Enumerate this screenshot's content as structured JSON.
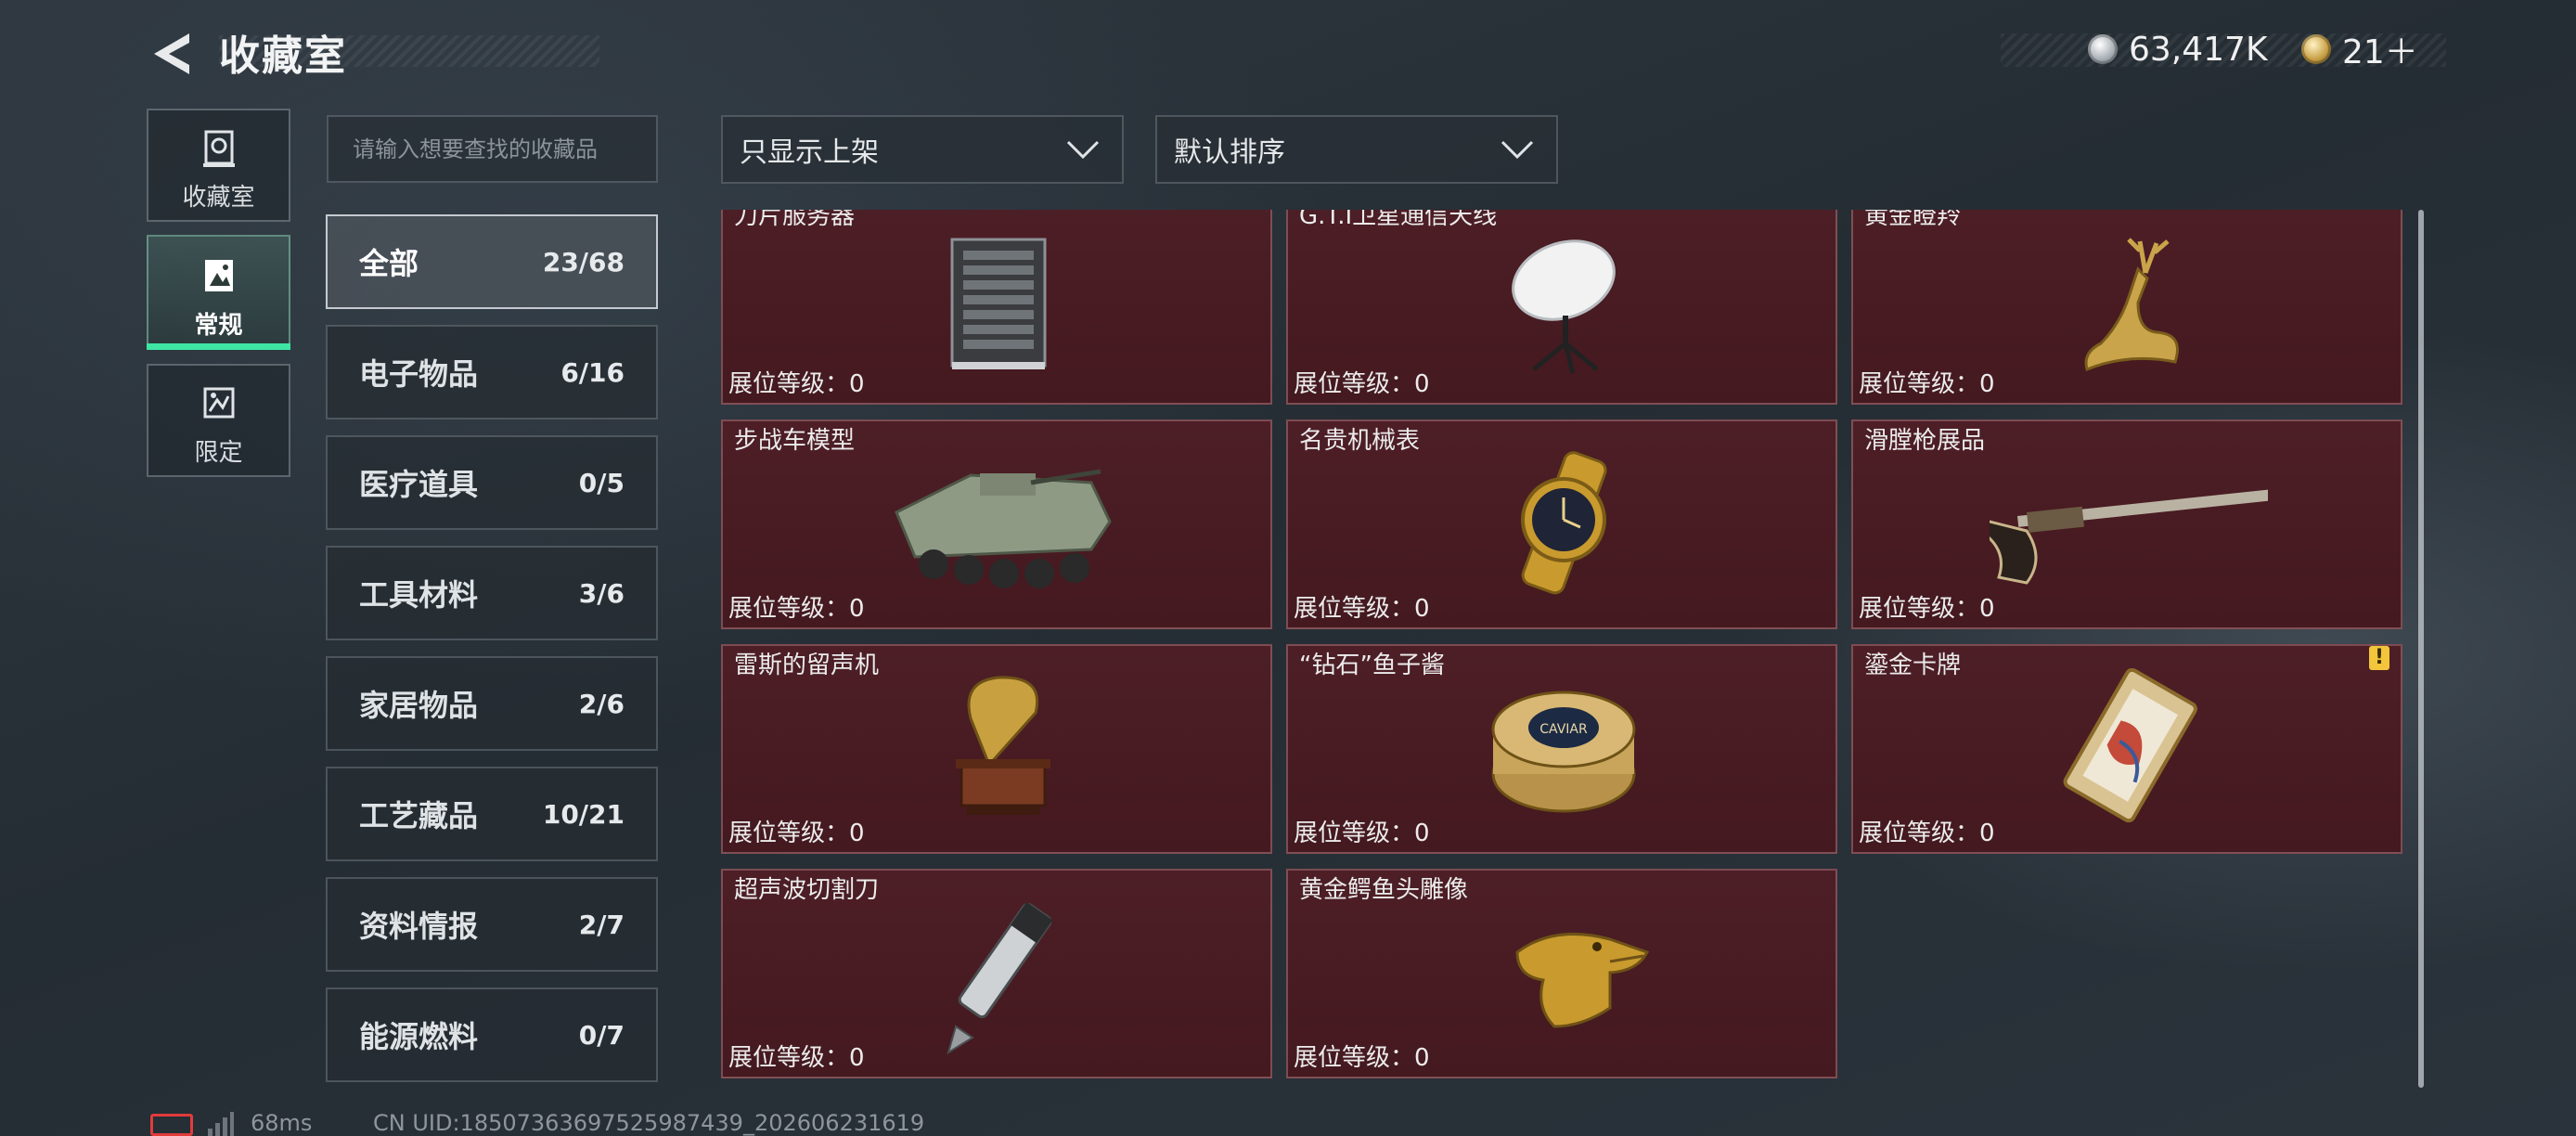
{
  "header": {
    "title": "收藏室",
    "currencies": [
      {
        "icon": "silver-coin-icon",
        "value": "63,417K"
      },
      {
        "icon": "gold-coin-icon",
        "value": "21＋"
      }
    ]
  },
  "rail": {
    "tabs": [
      {
        "label": "收藏室",
        "icon": "collection-room-icon"
      },
      {
        "label": "常规",
        "icon": "regular-icon",
        "active": true
      },
      {
        "label": "限定",
        "icon": "limited-icon"
      }
    ]
  },
  "search": {
    "placeholder": "请输入想要查找的收藏品"
  },
  "filters": {
    "display_filter": "只显示上架",
    "sort": "默认排序"
  },
  "categories": [
    {
      "name": "全部",
      "count": "23/68",
      "active": true
    },
    {
      "name": "电子物品",
      "count": "6/16"
    },
    {
      "name": "医疗道具",
      "count": "0/5"
    },
    {
      "name": "工具材料",
      "count": "3/6"
    },
    {
      "name": "家居物品",
      "count": "2/6"
    },
    {
      "name": "工艺藏品",
      "count": "10/21"
    },
    {
      "name": "资料情报",
      "count": "2/7"
    },
    {
      "name": "能源燃料",
      "count": "0/7"
    }
  ],
  "items": [
    {
      "name": "刀片服务器",
      "level": "展位等级：0",
      "icon": "blade-server-icon"
    },
    {
      "name": "G.T.I卫星通信天线",
      "level": "展位等级：0",
      "icon": "satellite-dish-icon"
    },
    {
      "name": "黄金瞪羚",
      "level": "展位等级：0",
      "icon": "golden-gazelle-icon"
    },
    {
      "name": "步战车模型",
      "level": "展位等级：0",
      "icon": "ifv-model-icon"
    },
    {
      "name": "名贵机械表",
      "level": "展位等级：0",
      "icon": "mechanical-watch-icon"
    },
    {
      "name": "滑膛枪展品",
      "level": "展位等级：0",
      "icon": "musket-icon"
    },
    {
      "name": "雷斯的留声机",
      "level": "展位等级：0",
      "icon": "gramophone-icon"
    },
    {
      "name": "“钻石”鱼子酱",
      "level": "展位等级：0",
      "icon": "caviar-tin-icon",
      "caviar_label": "CAVIAR"
    },
    {
      "name": "鎏金卡牌",
      "level": "展位等级：0",
      "icon": "gilded-card-icon",
      "badge": "!"
    },
    {
      "name": "超声波切割刀",
      "level": "展位等级：0",
      "icon": "ultrasonic-cutter-icon"
    },
    {
      "name": "黄金鳄鱼头雕像",
      "level": "展位等级：0",
      "icon": "golden-crocodile-head-icon"
    }
  ],
  "footer": {
    "ping": "68ms",
    "uid": "CN UID:18507363697525987439_202606231619"
  },
  "colors": {
    "accent": "#3ee6a4",
    "card_bg": "#4a1c23",
    "battery_low": "#e23b3b",
    "badge": "#f2c53a"
  }
}
